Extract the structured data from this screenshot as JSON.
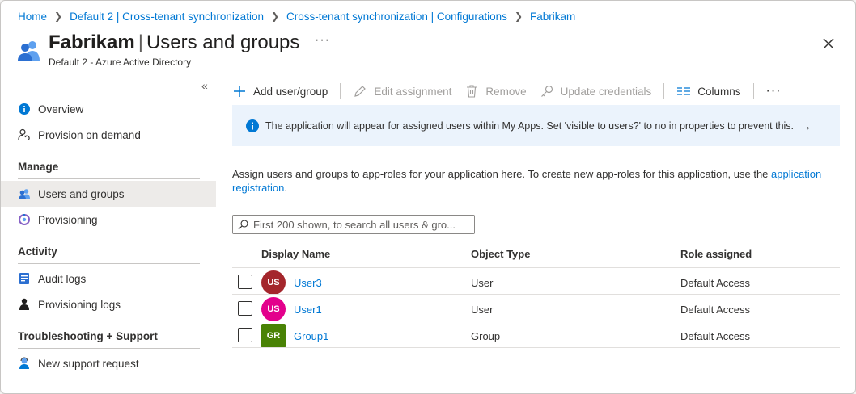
{
  "colors": {
    "accent": "#0078d4",
    "selected_nav_bg": "#edebe9",
    "banner_bg": "#ebf3fc",
    "avatar_user3": "#a4262c",
    "avatar_user1": "#e3008c",
    "avatar_group1": "#498205"
  },
  "breadcrumb": {
    "items": [
      "Home",
      "Default 2 | Cross-tenant synchronization",
      "Cross-tenant synchronization | Configurations",
      "Fabrikam"
    ]
  },
  "header": {
    "title_bold": "Fabrikam",
    "title_separator": "|",
    "title_rest": "Users and groups",
    "more_label": "···",
    "subtitle": "Default 2 - Azure Active Directory",
    "icon": "users-groups-icon",
    "close_icon": "close-icon"
  },
  "sidebar": {
    "collapse_label": "«",
    "items_top": [
      {
        "label": "Overview",
        "icon": "info-icon"
      },
      {
        "label": "Provision on demand",
        "icon": "person-sync-icon"
      }
    ],
    "sections": [
      {
        "header": "Manage",
        "items": [
          {
            "label": "Users and groups",
            "icon": "users-groups-icon",
            "selected": true
          },
          {
            "label": "Provisioning",
            "icon": "provisioning-icon"
          }
        ]
      },
      {
        "header": "Activity",
        "items": [
          {
            "label": "Audit logs",
            "icon": "audit-log-icon"
          },
          {
            "label": "Provisioning logs",
            "icon": "provisioning-log-icon"
          }
        ]
      },
      {
        "header": "Troubleshooting + Support",
        "items": [
          {
            "label": "New support request",
            "icon": "support-person-icon"
          }
        ]
      }
    ]
  },
  "toolbar": {
    "add": "Add user/group",
    "edit": "Edit assignment",
    "remove": "Remove",
    "update": "Update credentials",
    "columns": "Columns",
    "more": "···"
  },
  "banner": {
    "text": "The application will appear for assigned users within My Apps. Set 'visible to users?' to no in properties to prevent this.",
    "arrow": "→"
  },
  "description": {
    "text": "Assign users and groups to app-roles for your application here. To create new app-roles for this application, use the ",
    "link": "application registration",
    "end": "."
  },
  "search": {
    "placeholder": "First 200 shown, to search all users & gro..."
  },
  "table": {
    "columns": [
      "Display Name",
      "Object Type",
      "Role assigned"
    ],
    "rows": [
      {
        "initials": "US",
        "name": "User3",
        "type": "User",
        "role": "Default Access"
      },
      {
        "initials": "US",
        "name": "User1",
        "type": "User",
        "role": "Default Access"
      },
      {
        "initials": "GR",
        "name": "Group1",
        "type": "Group",
        "role": "Default Access"
      }
    ]
  }
}
